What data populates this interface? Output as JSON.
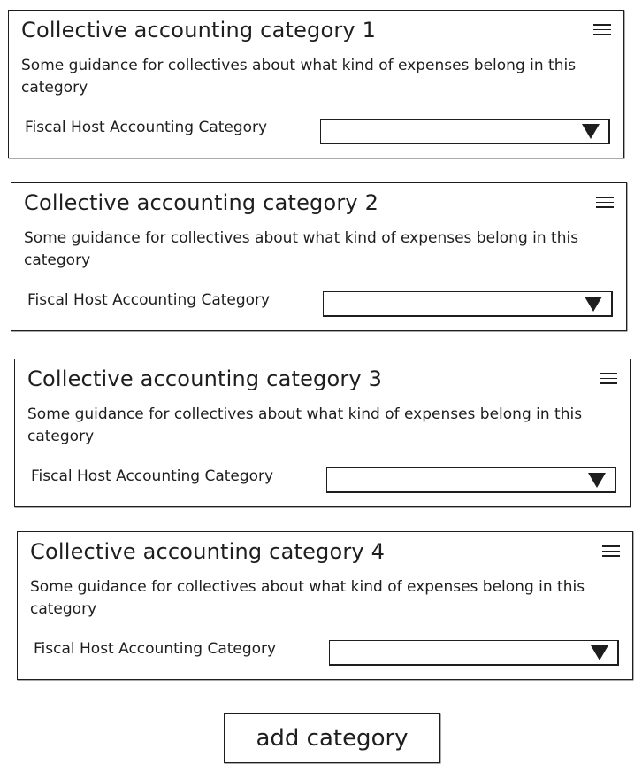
{
  "cards": [
    {
      "title": "Collective accounting category 1",
      "description": "Some guidance for collectives about what kind of expenses belong in this category",
      "field_label": "Fiscal Host Accounting Category",
      "selected_value": ""
    },
    {
      "title": "Collective accounting category 2",
      "description": "Some guidance for collectives about what kind of expenses belong in this category",
      "field_label": "Fiscal Host Accounting Category",
      "selected_value": ""
    },
    {
      "title": "Collective accounting category 3",
      "description": "Some guidance for collectives about what kind of expenses belong in this category",
      "field_label": "Fiscal Host Accounting Category",
      "selected_value": ""
    },
    {
      "title": "Collective accounting category 4",
      "description": "Some guidance for collectives about what kind of expenses belong in this category",
      "field_label": "Fiscal Host Accounting Category",
      "selected_value": ""
    }
  ],
  "add_button_label": "add category",
  "icons": {
    "menu": "hamburger-menu-icon",
    "dropdown": "triangle-down-icon"
  }
}
